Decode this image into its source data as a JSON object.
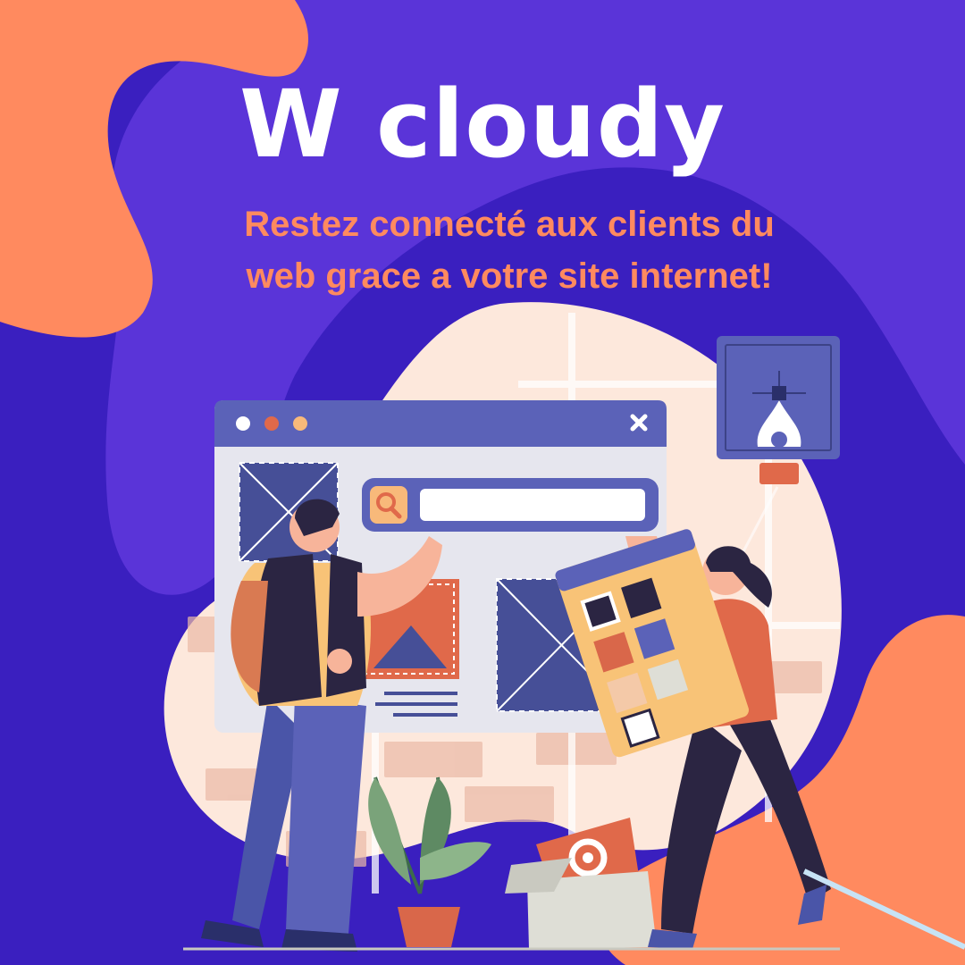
{
  "brand": {
    "title": "W cloudy",
    "tagline_line1": "Restez connecté aux clients du",
    "tagline_line2": "web grace a votre site internet!"
  },
  "colors": {
    "background": "#3a1fbf",
    "blob_purple": "#5a34d8",
    "accent_orange": "#ff8a5f",
    "title_white": "#ffffff",
    "browser_header": "#5b62b8",
    "browser_body": "#e8e8ee",
    "image_placeholder": "#464f97"
  },
  "illustration": {
    "browser_window_controls": [
      "dot-white",
      "dot-orange",
      "dot-peach",
      "close-x"
    ],
    "icons": [
      "search-icon",
      "pen-tool-icon",
      "gear-icon",
      "close-icon"
    ]
  }
}
